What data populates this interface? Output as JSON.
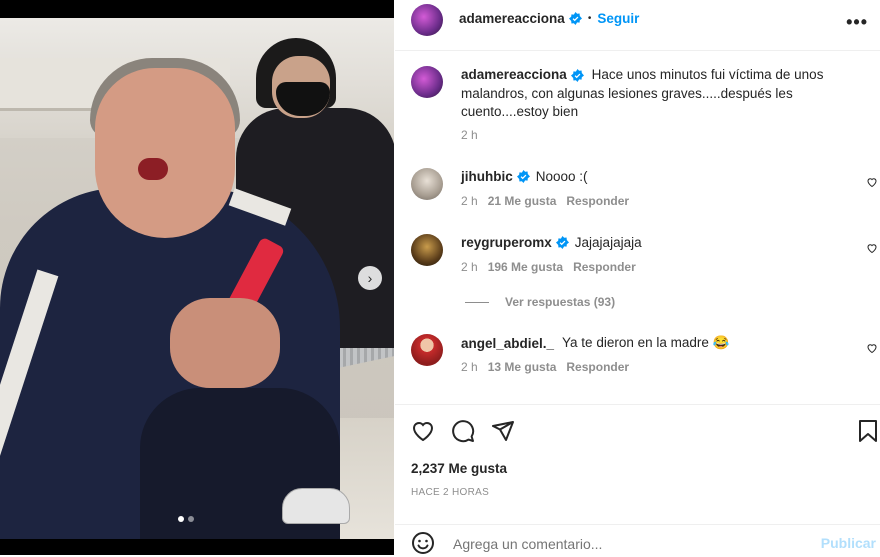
{
  "post": {
    "username": "adamereacciona",
    "follow_label": "Seguir",
    "bullet": "•",
    "more_label": "•••",
    "caption": "Hace unos minutos fui víctima de unos malandros, con algunas lesiones graves.....después les cuento....estoy bien",
    "caption_time": "2 h"
  },
  "comments": [
    {
      "username": "jihuhbic",
      "text": "Noooo :(",
      "time": "2 h",
      "likes": "21 Me gusta",
      "reply": "Responder",
      "verified": true
    },
    {
      "username": "reygruperomx",
      "text": "Jajajajajaja",
      "time": "2 h",
      "likes": "196 Me gusta",
      "reply": "Responder",
      "verified": true
    },
    {
      "username": "angel_abdiel._",
      "text": "Ya te dieron en la madre 😂",
      "time": "2 h",
      "likes": "13 Me gusta",
      "reply": "Responder",
      "verified": false
    }
  ],
  "view_replies": "Ver respuestas (93)",
  "stats": {
    "likes": "2,237 Me gusta",
    "time": "HACE 2 HORAS"
  },
  "composer": {
    "placeholder": "Agrega un comentario...",
    "publish": "Publicar"
  },
  "carousel": {
    "next": "›",
    "count": 2,
    "active": 0
  },
  "colors": {
    "accent": "#0095f6",
    "verified": "#0095f6",
    "publish_disabled": "#b2dffc"
  }
}
